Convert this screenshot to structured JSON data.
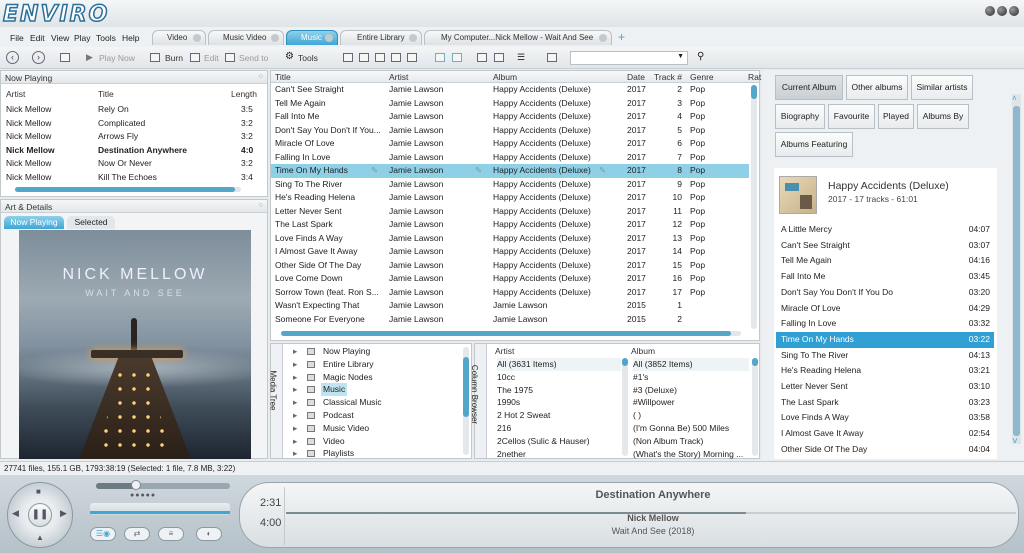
{
  "app": {
    "logo": "ENVIRO"
  },
  "menu": [
    "File",
    "Edit",
    "View",
    "Play",
    "Tools",
    "Help"
  ],
  "tabs": [
    {
      "label": "Video"
    },
    {
      "label": "Music Video"
    },
    {
      "label": "Music",
      "active": true
    },
    {
      "label": "Entire Library"
    },
    {
      "label": "My Computer...Nick Mellow - Wait And See"
    }
  ],
  "toolbar": {
    "play_now": "Play Now",
    "burn": "Burn",
    "edit": "Edit",
    "send_to": "Send to",
    "tools": "Tools"
  },
  "now_playing": {
    "title": "Now Playing",
    "cols": [
      "Artist",
      "Title",
      "Length"
    ],
    "rows": [
      [
        "Nick Mellow",
        "Rely On",
        "3:5"
      ],
      [
        "Nick Mellow",
        "Complicated",
        "3:2"
      ],
      [
        "Nick Mellow",
        "Arrows Fly",
        "3:2"
      ],
      [
        "Nick Mellow",
        "Destination Anywhere",
        "4:0"
      ],
      [
        "Nick Mellow",
        "Now Or Never",
        "3:2"
      ],
      [
        "Nick Mellow",
        "Kill The Echoes",
        "3:4"
      ]
    ],
    "playing_index": 3
  },
  "art": {
    "title": "Art & Details",
    "tabs": [
      "Now Playing",
      "Selected"
    ],
    "artist": "NICK MELLOW",
    "album": "WAIT AND SEE"
  },
  "tracklist": {
    "cols": [
      "Title",
      "Artist",
      "Album",
      "Date",
      "Track #",
      "Genre",
      "Rat"
    ],
    "rows": [
      [
        "Can't See Straight",
        "Jamie Lawson",
        "Happy Accidents (Deluxe)",
        "2017",
        "2",
        "Pop"
      ],
      [
        "Tell Me Again",
        "Jamie Lawson",
        "Happy Accidents (Deluxe)",
        "2017",
        "3",
        "Pop"
      ],
      [
        "Fall Into Me",
        "Jamie Lawson",
        "Happy Accidents (Deluxe)",
        "2017",
        "4",
        "Pop"
      ],
      [
        "Don't Say You Don't If You...",
        "Jamie Lawson",
        "Happy Accidents (Deluxe)",
        "2017",
        "5",
        "Pop"
      ],
      [
        "Miracle Of Love",
        "Jamie Lawson",
        "Happy Accidents (Deluxe)",
        "2017",
        "6",
        "Pop"
      ],
      [
        "Falling In Love",
        "Jamie Lawson",
        "Happy Accidents (Deluxe)",
        "2017",
        "7",
        "Pop"
      ],
      [
        "Time On My Hands",
        "Jamie Lawson",
        "Happy Accidents (Deluxe)",
        "2017",
        "8",
        "Pop"
      ],
      [
        "Sing To The River",
        "Jamie Lawson",
        "Happy Accidents (Deluxe)",
        "2017",
        "9",
        "Pop"
      ],
      [
        "He's Reading Helena",
        "Jamie Lawson",
        "Happy Accidents (Deluxe)",
        "2017",
        "10",
        "Pop"
      ],
      [
        "Letter Never Sent",
        "Jamie Lawson",
        "Happy Accidents (Deluxe)",
        "2017",
        "11",
        "Pop"
      ],
      [
        "The Last Spark",
        "Jamie Lawson",
        "Happy Accidents (Deluxe)",
        "2017",
        "12",
        "Pop"
      ],
      [
        "Love Finds A Way",
        "Jamie Lawson",
        "Happy Accidents (Deluxe)",
        "2017",
        "13",
        "Pop"
      ],
      [
        "I Almost Gave It Away",
        "Jamie Lawson",
        "Happy Accidents (Deluxe)",
        "2017",
        "14",
        "Pop"
      ],
      [
        "Other Side Of The Day",
        "Jamie Lawson",
        "Happy Accidents (Deluxe)",
        "2017",
        "15",
        "Pop"
      ],
      [
        "Love Come Down",
        "Jamie Lawson",
        "Happy Accidents (Deluxe)",
        "2017",
        "16",
        "Pop"
      ],
      [
        "Sorrow Town (feat. Ron S...",
        "Jamie Lawson",
        "Happy Accidents (Deluxe)",
        "2017",
        "17",
        "Pop"
      ],
      [
        "Wasn't Expecting That",
        "Jamie Lawson",
        "Jamie Lawson",
        "2015",
        "1",
        ""
      ],
      [
        "Someone For Everyone",
        "Jamie Lawson",
        "Jamie Lawson",
        "2015",
        "2",
        ""
      ]
    ],
    "selected_index": 6
  },
  "media_tree": {
    "label": "Media Tree",
    "items": [
      "Now Playing",
      "Entire Library",
      "Magic Nodes",
      "Music",
      "Classical Music",
      "Podcast",
      "Music Video",
      "Video",
      "Playlists"
    ],
    "selected_index": 3
  },
  "column_browser": {
    "label": "Column Browser",
    "artist_header": "Artist",
    "album_header": "Album",
    "artists": [
      "All (3631 Items)",
      "10cc",
      "The 1975",
      "1990s",
      "2 Hot 2 Sweat",
      "216",
      "2Cellos (Sulic & Hauser)",
      "2nether"
    ],
    "albums": [
      "All (3852 Items)",
      "#1's",
      "#3 (Deluxe)",
      "#Willpower",
      "( )",
      "(I'm Gonna Be) 500 Miles",
      "(Non Album Track)",
      "(What's the Story) Morning ..."
    ]
  },
  "info_buttons": [
    "Current Album",
    "Other albums",
    "Similar artists",
    "Biography",
    "Favourite",
    "Played",
    "Albums By",
    "Albums Featuring"
  ],
  "album_info": {
    "title": "Happy Accidents (Deluxe)",
    "sub": "2017 - 17 tracks - 61:01",
    "tracks": [
      [
        "A Little Mercy",
        "04:07"
      ],
      [
        "Can't See Straight",
        "03:07"
      ],
      [
        "Tell Me Again",
        "04:16"
      ],
      [
        "Fall Into Me",
        "03:45"
      ],
      [
        "Don't Say You Don't If You Do",
        "03:20"
      ],
      [
        "Miracle Of Love",
        "04:29"
      ],
      [
        "Falling In Love",
        "03:32"
      ],
      [
        "Time On My Hands",
        "03:22"
      ],
      [
        "Sing To The River",
        "04:13"
      ],
      [
        "He's Reading Helena",
        "03:21"
      ],
      [
        "Letter Never Sent",
        "03:10"
      ],
      [
        "The Last Spark",
        "03:23"
      ],
      [
        "Love Finds A Way",
        "03:58"
      ],
      [
        "I Almost Gave It Away",
        "02:54"
      ],
      [
        "Other Side Of The Day",
        "04:04"
      ]
    ],
    "selected_index": 7
  },
  "status": "27741 files, 155.1 GB, 1793:38:19 (Selected: 1 file, 7.8 MB, 3:22)",
  "player": {
    "elapsed": "2:31",
    "total": "4:00",
    "title": "Destination Anywhere",
    "artist": "Nick Mellow",
    "album": "Wait And See (2018)",
    "volume": 0.3,
    "progress": 0.63
  },
  "colors": {
    "accent": "#3fa6d6",
    "selection": "#8fd0e6",
    "logo": "#2a6f9a"
  }
}
